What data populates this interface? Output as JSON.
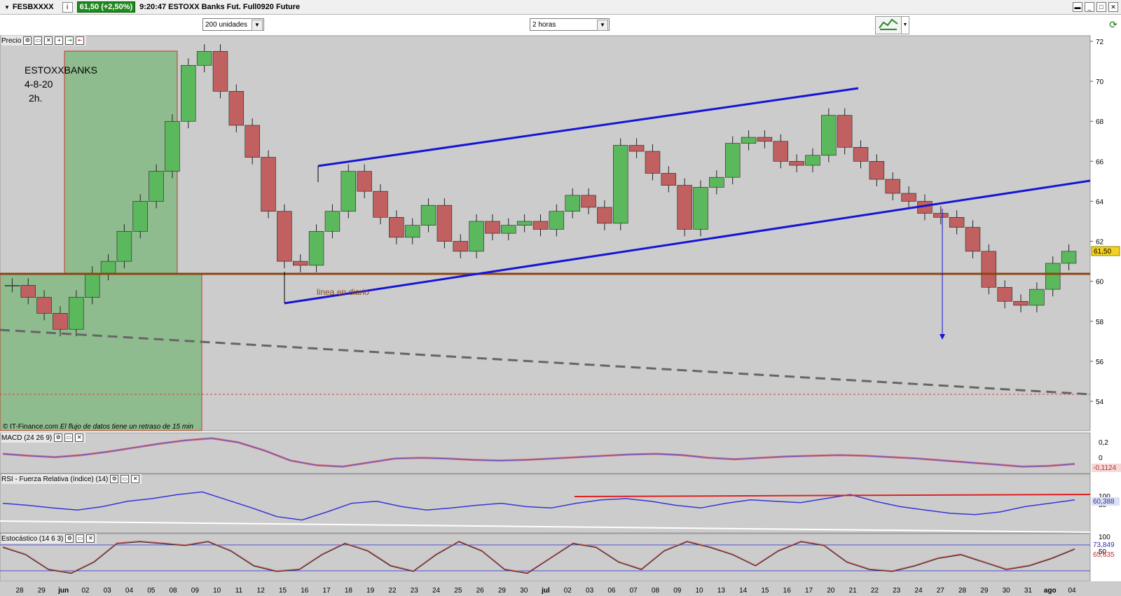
{
  "titlebar": {
    "symbol": "FESBXXXX",
    "info_icon": "i",
    "price_badge": "61,50 (+2,50%)",
    "title": "9:20:47 ESTOXX Banks Fut. Full0920 Future"
  },
  "toolbar": {
    "units_select": "200 unidades",
    "timeframe_select": "2 horas"
  },
  "panels": {
    "price": "Precio",
    "macd": "MACD (24 26 9)",
    "rsi": "RSI - Fuerza Relativa (índice) (14)",
    "stoch": "Estocástico (14 6 3)"
  },
  "annotation": {
    "line1": "ESTOXXBANKS",
    "line2": "4-8-20",
    "line3": "2h.",
    "diario": "linea en diario"
  },
  "copyright": {
    "source": "© IT-Finance.com",
    "delay": "El flujo de datos tiene un retraso de 15 min"
  },
  "colors": {
    "up": "#5cb85c",
    "down": "#c06060",
    "channel": "#1515d6",
    "support": "#8b4513",
    "zone": "#8fbc8f",
    "price_label": "#f2d024"
  },
  "chart_data": {
    "type": "candlestick",
    "price_axis": {
      "ylim": [
        53,
        72
      ],
      "ticks": [
        "72",
        "70",
        "68",
        "66",
        "64",
        "62",
        "60",
        "58",
        "56",
        "54"
      ]
    },
    "last_price": "61,50",
    "x_labels": [
      "28",
      "29",
      "jun",
      "02",
      "03",
      "04",
      "05",
      "08",
      "09",
      "10",
      "11",
      "12",
      "15",
      "16",
      "17",
      "18",
      "19",
      "22",
      "23",
      "24",
      "25",
      "26",
      "29",
      "30",
      "jul",
      "02",
      "03",
      "06",
      "07",
      "08",
      "09",
      "10",
      "13",
      "14",
      "15",
      "16",
      "17",
      "20",
      "21",
      "22",
      "23",
      "24",
      "27",
      "28",
      "29",
      "30",
      "31",
      "ago",
      "04"
    ],
    "close_path": [
      59.8,
      59.2,
      58.4,
      57.6,
      59.2,
      60.4,
      61.0,
      62.5,
      64.0,
      65.5,
      68.0,
      70.8,
      71.5,
      69.5,
      67.8,
      66.2,
      63.5,
      61.0,
      60.8,
      62.5,
      63.5,
      65.5,
      64.5,
      63.2,
      62.2,
      62.8,
      63.8,
      62.0,
      61.5,
      63.0,
      62.4,
      62.8,
      63.0,
      62.6,
      63.5,
      64.3,
      63.7,
      62.9,
      66.8,
      66.5,
      65.4,
      64.8,
      62.6,
      64.7,
      65.2,
      66.9,
      67.2,
      67.0,
      66.0,
      65.8,
      66.3,
      68.3,
      66.7,
      66.0,
      65.1,
      64.4,
      64.0,
      63.4,
      63.2,
      62.7,
      61.5,
      59.7,
      59.0,
      58.8,
      59.6,
      60.9,
      61.5
    ],
    "macd_axis": {
      "ticks": [
        "0,2",
        "0"
      ],
      "last": "-0,1124"
    },
    "macd": [
      0.05,
      0.02,
      0.0,
      0.03,
      0.08,
      0.14,
      0.2,
      0.25,
      0.28,
      0.22,
      0.1,
      -0.05,
      -0.12,
      -0.14,
      -0.08,
      -0.02,
      -0.01,
      -0.02,
      -0.04,
      -0.05,
      -0.04,
      -0.02,
      0.0,
      0.02,
      0.04,
      0.05,
      0.03,
      -0.01,
      -0.03,
      -0.01,
      0.01,
      0.02,
      0.03,
      0.02,
      0.0,
      -0.02,
      -0.05,
      -0.08,
      -0.11,
      -0.14,
      -0.13,
      -0.1
    ],
    "rsi_axis": {
      "ticks": [
        "100",
        "50"
      ],
      "last": "60,388"
    },
    "rsi": [
      55,
      52,
      48,
      45,
      50,
      58,
      62,
      68,
      72,
      60,
      48,
      35,
      30,
      42,
      55,
      58,
      50,
      45,
      48,
      52,
      55,
      50,
      48,
      55,
      60,
      62,
      58,
      52,
      48,
      55,
      60,
      58,
      56,
      62,
      68,
      58,
      50,
      45,
      40,
      38,
      42,
      50,
      55,
      60
    ],
    "stoch_axis": {
      "ticks": [
        "100",
        "50"
      ],
      "last_k": "73,849",
      "last_d": "65,635"
    },
    "stoch": [
      80,
      60,
      20,
      10,
      40,
      90,
      95,
      90,
      85,
      95,
      70,
      30,
      15,
      20,
      60,
      90,
      70,
      30,
      15,
      60,
      95,
      70,
      20,
      10,
      50,
      90,
      80,
      40,
      20,
      70,
      95,
      80,
      60,
      30,
      70,
      95,
      85,
      40,
      20,
      15,
      30,
      50,
      60,
      40,
      20,
      30,
      50,
      75
    ]
  }
}
